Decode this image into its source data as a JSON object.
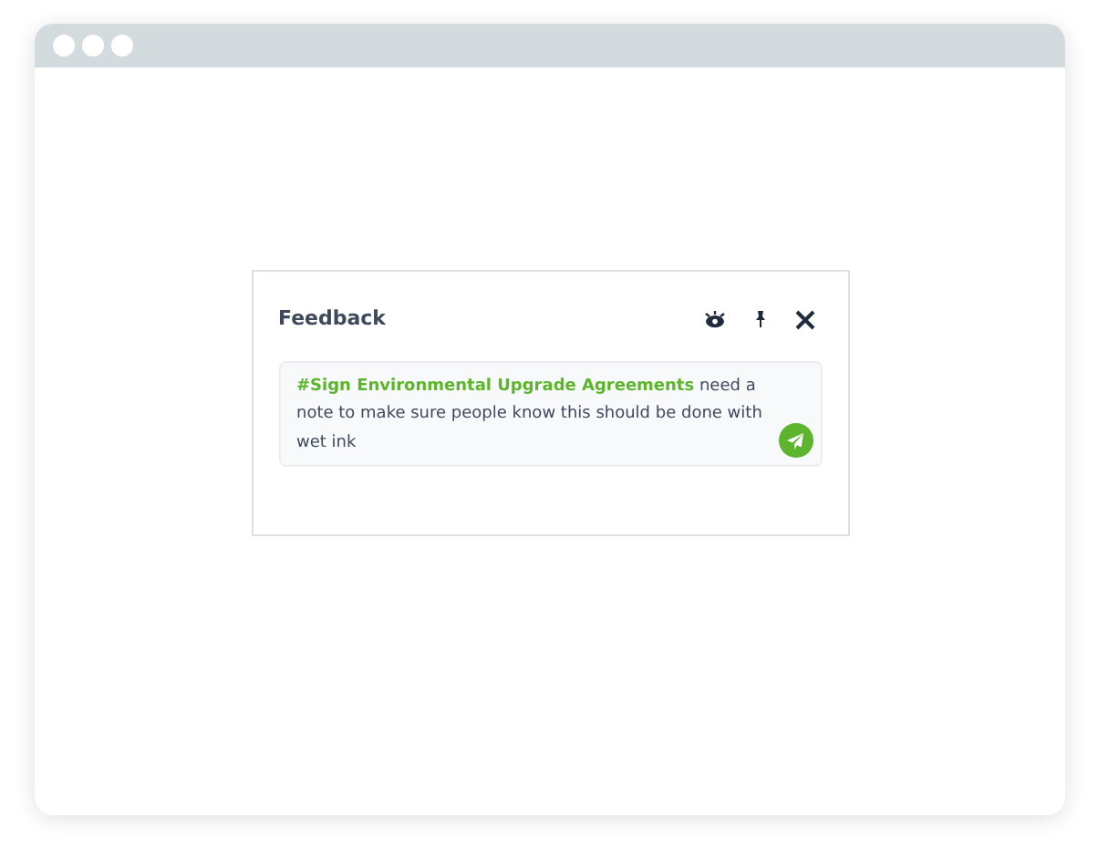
{
  "panel": {
    "title": "Feedback"
  },
  "message": {
    "tag": "#Sign Environmental Upgrade Agreements",
    "text": " need a note to make sure people know this should be done with wet ink"
  }
}
